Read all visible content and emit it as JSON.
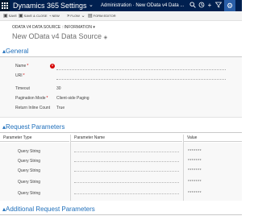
{
  "nav": {
    "brand": "Dynamics 365",
    "area": "Settings",
    "area_chevron": "⌄",
    "breadcrumb": "Administration · New OData v4 Data ...",
    "icons": [
      "search-icon",
      "history-icon",
      "add-icon",
      "filter-icon",
      "settings-icon"
    ]
  },
  "toolbar": {
    "save_label": "SAVE",
    "save_close_label": "SAVE & CLOSE",
    "new_label": "+ NEW",
    "flow_label": "FLOW",
    "form_editor_label": "FORM EDITOR"
  },
  "header": {
    "kicker": "ODATA V4 DATA SOURCE : INFORMATION",
    "title": "New OData v4 Data Source"
  },
  "general": {
    "title": "General",
    "fields": [
      {
        "label": "Name",
        "required": true,
        "value": ""
      },
      {
        "label": "URI",
        "required": true,
        "value": ""
      },
      {
        "label": "Timeout",
        "required": false,
        "value": "30"
      },
      {
        "label": "Pagination Mode",
        "required": true,
        "value": "Client-side Paging"
      },
      {
        "label": "Return Inline Count",
        "required": false,
        "value": "True"
      }
    ],
    "required_mark": "*",
    "error_icon": "error-icon"
  },
  "request_parameters": {
    "title": "Request Parameters",
    "columns": [
      "Parameter Type",
      "Parameter Name",
      "Value"
    ],
    "rows": [
      {
        "type": "Query String",
        "name": "",
        "value": "*******"
      },
      {
        "type": "Query String",
        "name": "",
        "value": "*******"
      },
      {
        "type": "Query String",
        "name": "",
        "value": "*******"
      },
      {
        "type": "Query String",
        "name": "",
        "value": "*******"
      },
      {
        "type": "Query String",
        "name": "",
        "value": "*******"
      }
    ]
  },
  "additional": {
    "title": "Additional Request Parameters"
  },
  "colors": {
    "nav_bg": "#002050",
    "accent": "#1f6fbb",
    "error": "#d50000"
  }
}
